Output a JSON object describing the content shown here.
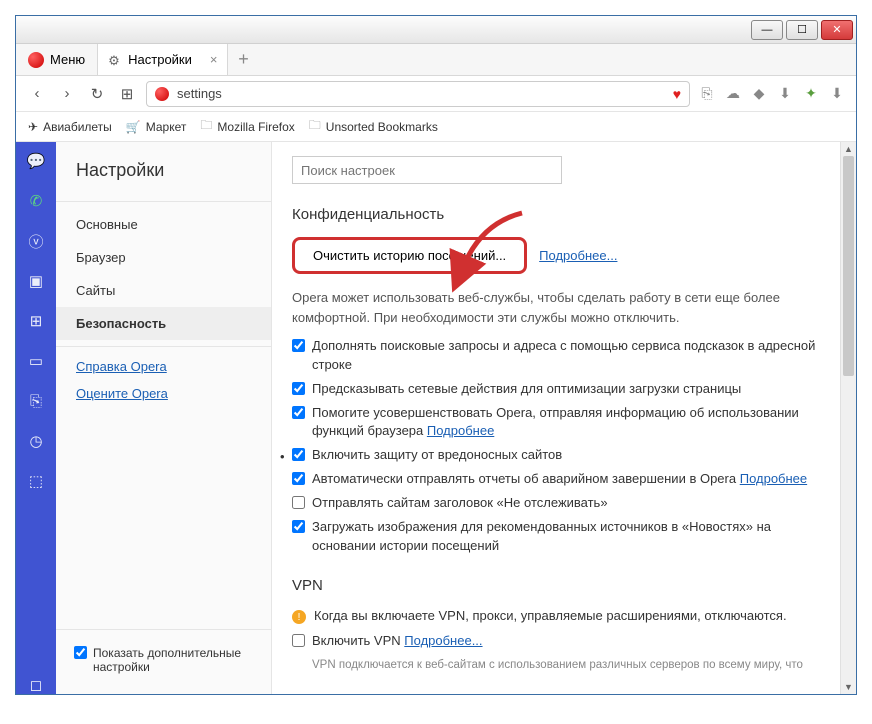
{
  "window": {
    "min": "—",
    "max": "☐",
    "close": "✕"
  },
  "menu_label": "Меню",
  "tab": {
    "title": "Настройки",
    "close": "×",
    "new": "+"
  },
  "nav": {
    "back": "‹",
    "fwd": "›",
    "reload": "↻",
    "speed": "⊞"
  },
  "address": {
    "value": "settings",
    "heart": "♥"
  },
  "toolbar_icons": {
    "a": "⎘",
    "b": "☁",
    "c": "◆",
    "d": "⬇",
    "e": "✦",
    "f": "⬇"
  },
  "bookmarks": {
    "a": "Авиабилеты",
    "b": "Маркет",
    "c": "Mozilla Firefox",
    "d": "Unsorted Bookmarks"
  },
  "settings_title": "Настройки",
  "nav_items": {
    "basic": "Основные",
    "browser": "Браузер",
    "sites": "Сайты",
    "security": "Безопасность"
  },
  "nav_links": {
    "help": "Справка Opera",
    "rate": "Оцените Opera"
  },
  "show_advanced": "Показать дополнительные настройки",
  "search_placeholder": "Поиск настроек",
  "privacy": {
    "heading": "Конфиденциальность",
    "clear_btn": "Очистить историю посещений...",
    "learn_more": "Подробнее...",
    "desc": "Opera может использовать веб-службы, чтобы сделать работу в сети еще более комфортной. При необходимости эти службы можно отключить.",
    "c1": "Дополнять поисковые запросы и адреса с помощью сервиса подсказок в адресной строке",
    "c2": "Предсказывать сетевые действия для оптимизации загрузки страницы",
    "c3a": "Помогите усовершенствовать Opera, отправляя информацию об использовании функций браузера ",
    "c3b": "Подробнее",
    "c4": "Включить защиту от вредоносных сайтов",
    "c5a": "Автоматически отправлять отчеты об аварийном завершении в Opera ",
    "c5b": "Подробнее",
    "c6": "Отправлять сайтам заголовок «Не отслеживать»",
    "c7": "Загружать изображения для рекомендованных источников в «Новостях» на основании истории посещений"
  },
  "vpn": {
    "heading": "VPN",
    "warn": "Когда вы включаете VPN, прокси, управляемые расширениями, отключаются.",
    "enable": "Включить VPN ",
    "more": "Подробнее...",
    "note": "VPN подключается к веб-сайтам с использованием различных серверов по всему миру, что"
  }
}
